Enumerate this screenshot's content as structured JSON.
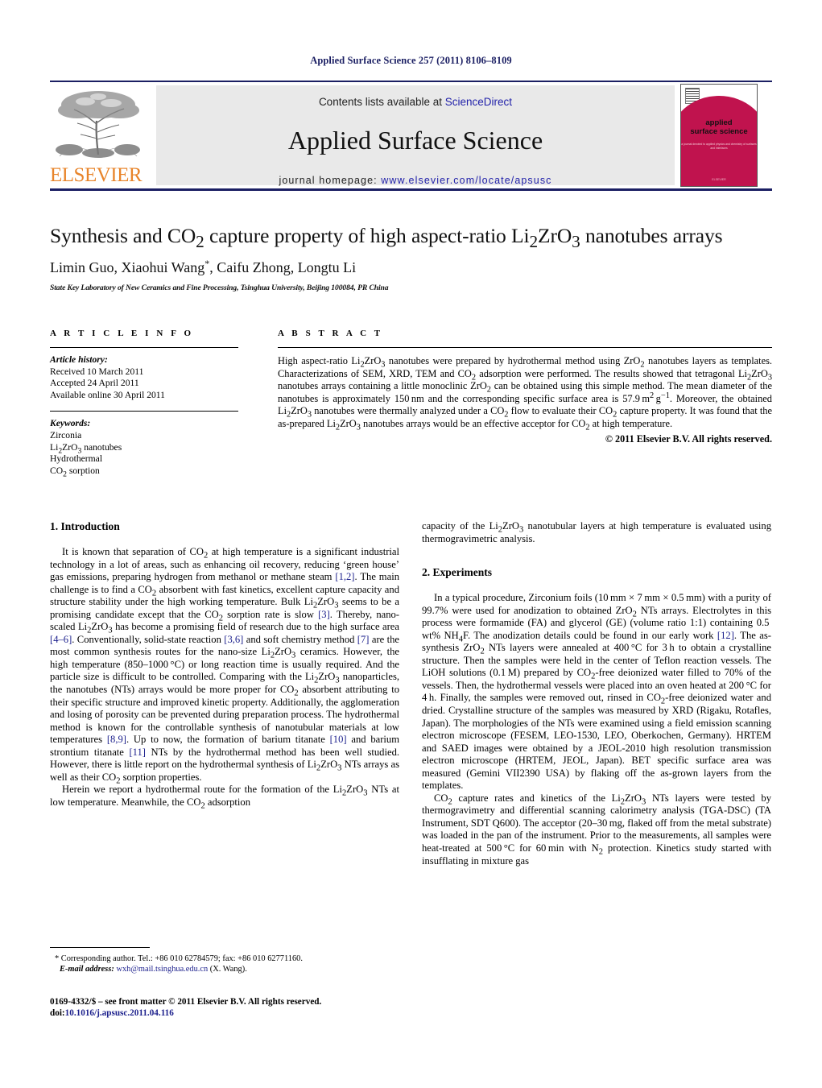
{
  "running_head": "Applied Surface Science 257 (2011) 8106–8109",
  "masthead": {
    "contents_prefix": "Contents lists available at ",
    "sciencedirect": "ScienceDirect",
    "journal_name": "Applied Surface Science",
    "homepage_prefix": "journal homepage: ",
    "homepage_url": "www.elsevier.com/locate/apsusc",
    "publisher": "ELSEVIER",
    "cover": {
      "title_line1": "applied",
      "title_line2": "surface science",
      "subtitle": "a journal devoted to applied physics and chemistry of surfaces and interfaces",
      "footer": "ELSEVIER"
    },
    "colors": {
      "rule": "#1b1f63",
      "link": "#2222aa",
      "banner_bg": "#e9e9e9",
      "elsevier_orange": "#e8842a",
      "cover_crimson": "#c0134e"
    }
  },
  "article": {
    "title_parts": {
      "p1": "Synthesis and CO",
      "sub1": "2",
      "p2": " capture property of high aspect-ratio Li",
      "sub2": "2",
      "p3": "ZrO",
      "sub3": "3",
      "p4": " nanotubes arrays"
    },
    "authors_pre": "Limin Guo, Xiaohui Wang",
    "authors_star": "*",
    "authors_post": ", Caifu Zhong, Longtu Li",
    "affiliation": "State Key Laboratory of New Ceramics and Fine Processing, Tsinghua University, Beijing 100084, PR China"
  },
  "article_info": {
    "heading": "A R T I C L E   I N F O",
    "history_label": "Article history:",
    "history": [
      "Received 10 March 2011",
      "Accepted 24 April 2011",
      "Available online 30 April 2011"
    ],
    "keywords_label": "Keywords:",
    "keywords": [
      "Zirconia",
      "Li2ZrO3 nanotubes",
      "Hydrothermal",
      "CO2 sorption"
    ]
  },
  "abstract": {
    "heading": "A B S T R A C T",
    "text": "High aspect-ratio Li2ZrO3 nanotubes were prepared by hydrothermal method using ZrO2 nanotubes layers as templates. Characterizations of SEM, XRD, TEM and CO2 adsorption were performed. The results showed that tetragonal Li2ZrO3 nanotubes arrays containing a little monoclinic ZrO2 can be obtained using this simple method. The mean diameter of the nanotubes is approximately 150 nm and the corresponding specific surface area is 57.9 m2 g−1. Moreover, the obtained Li2ZrO3 nanotubes were thermally analyzed under a CO2 flow to evaluate their CO2 capture property. It was found that the as-prepared Li2ZrO3 nanotubes arrays would be an effective acceptor for CO2 at high temperature.",
    "copyright": "© 2011 Elsevier B.V. All rights reserved."
  },
  "sections": {
    "introduction_heading": "1.  Introduction",
    "experiments_heading": "2.  Experiments",
    "intro_p1": "It is known that separation of CO2 at high temperature is a significant industrial technology in a lot of areas, such as enhancing oil recovery, reducing 'green house' gas emissions, preparing hydrogen from methanol or methane steam [1,2]. The main challenge is to find a CO2 absorbent with fast kinetics, excellent capture capacity and structure stability under the high working temperature. Bulk Li2ZrO3 seems to be a promising candidate except that the CO2 sorption rate is slow [3]. Thereby, nano-scaled Li2ZrO3 has become a promising field of research due to the high surface area [4–6]. Conventionally, solid-state reaction [3,6] and soft chemistry method [7] are the most common synthesis routes for the nano-size Li2ZrO3 ceramics. However, the high temperature (850–1000 °C) or long reaction time is usually required. And the particle size is difficult to be controlled. Comparing with the Li2ZrO3 nanoparticles, the nanotubes (NTs) arrays would be more proper for CO2 absorbent attributing to their specific structure and improved kinetic property. Additionally, the agglomeration and losing of porosity can be prevented during preparation process. The hydrothermal method is known for the controllable synthesis of nanotubular materials at low temperatures [8,9]. Up to now, the formation of barium titanate [10] and barium strontium titanate [11] NTs by the hydrothermal method has been well studied. However, there is little report on the hydrothermal synthesis of Li2ZrO3 NTs arrays as well as their CO2 sorption properties.",
    "intro_p2": "Herein we report a hydrothermal route for the formation of the Li2ZrO3 NTs at low temperature. Meanwhile, the CO2 adsorption capacity of the Li2ZrO3 nanotubular layers at high temperature is evaluated using thermogravimetric analysis.",
    "exp_p1": "In a typical procedure, Zirconium foils (10 mm × 7 mm × 0.5 mm) with a purity of 99.7% were used for anodization to obtained ZrO2 NTs arrays. Electrolytes in this process were formamide (FA) and glycerol (GE) (volume ratio 1:1) containing 0.5 wt% NH4F. The anodization details could be found in our early work [12]. The as-synthesis ZrO2 NTs layers were annealed at 400 °C for 3 h to obtain a crystalline structure. Then the samples were held in the center of Teflon reaction vessels. The LiOH solutions (0.1 M) prepared by CO2-free deionized water filled to 70% of the vessels. Then, the hydrothermal vessels were placed into an oven heated at 200 °C for 4 h. Finally, the samples were removed out, rinsed in CO2-free deionized water and dried. Crystalline structure of the samples was measured by XRD (Rigaku, Rotafles, Japan). The morphologies of the NTs were examined using a field emission scanning electron microscope (FESEM, LEO-1530, LEO, Oberkochen, Germany). HRTEM and SAED images were obtained by a JEOL-2010 high resolution transmission electron microscope (HRTEM, JEOL, Japan). BET specific surface area was measured (Gemini VII2390 USA) by flaking off the as-grown layers from the templates.",
    "exp_p2": "CO2 capture rates and kinetics of the Li2ZrO3 NTs layers were tested by thermogravimetry and differential scanning calorimetry analysis (TGA-DSC) (TA Instrument, SDT Q600). The acceptor (20–30 mg, flaked off from the metal substrate) was loaded in the pan of the instrument. Prior to the measurements, all samples were heat-treated at 500 °C for 60 min with N2 protection. Kinetics study started with insufflating in mixture gas"
  },
  "footnote": {
    "star": "*",
    "corresponding": " Corresponding author. Tel.: +86 010 62784579; fax: +86 010 62771160.",
    "email_label": "E-mail address:",
    "email": "wxh@mail.tsinghua.edu.cn",
    "email_owner": " (X. Wang).",
    "imprint": "0169-4332/$ – see front matter © 2011 Elsevier B.V. All rights reserved.",
    "doi_label": "doi:",
    "doi": "10.1016/j.apsusc.2011.04.116"
  }
}
